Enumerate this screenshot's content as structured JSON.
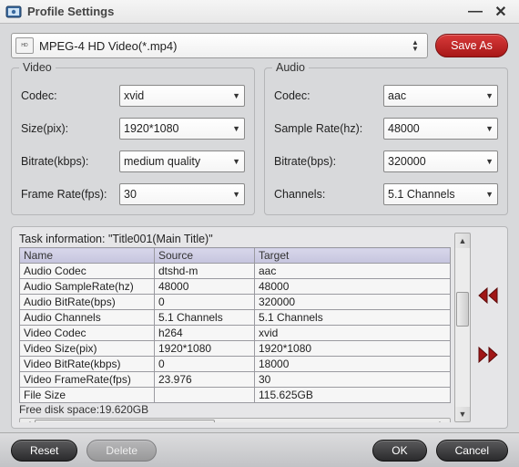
{
  "window": {
    "title": "Profile Settings"
  },
  "profile": {
    "selected": "MPEG-4 HD Video(*.mp4)",
    "save_as": "Save As"
  },
  "video": {
    "legend": "Video",
    "codec_label": "Codec:",
    "codec": "xvid",
    "size_label": "Size(pix):",
    "size": "1920*1080",
    "bitrate_label": "Bitrate(kbps):",
    "bitrate": "medium quality",
    "framerate_label": "Frame Rate(fps):",
    "framerate": "30"
  },
  "audio": {
    "legend": "Audio",
    "codec_label": "Codec:",
    "codec": "aac",
    "samplerate_label": "Sample Rate(hz):",
    "samplerate": "48000",
    "bitrate_label": "Bitrate(bps):",
    "bitrate": "320000",
    "channels_label": "Channels:",
    "channels": "5.1 Channels"
  },
  "task": {
    "caption": "Task information: \"Title001(Main Title)\"",
    "headers": {
      "name": "Name",
      "source": "Source",
      "target": "Target"
    },
    "rows": [
      {
        "name": "Audio Codec",
        "source": "dtshd-m",
        "target": "aac"
      },
      {
        "name": "Audio SampleRate(hz)",
        "source": "48000",
        "target": "48000"
      },
      {
        "name": "Audio BitRate(bps)",
        "source": "0",
        "target": "320000"
      },
      {
        "name": "Audio Channels",
        "source": "5.1 Channels",
        "target": "5.1 Channels"
      },
      {
        "name": "Video Codec",
        "source": "h264",
        "target": "xvid"
      },
      {
        "name": "Video Size(pix)",
        "source": "1920*1080",
        "target": "1920*1080"
      },
      {
        "name": "Video BitRate(kbps)",
        "source": "0",
        "target": "18000"
      },
      {
        "name": "Video FrameRate(fps)",
        "source": "23.976",
        "target": "30"
      },
      {
        "name": "File Size",
        "source": "",
        "target": "115.625GB"
      }
    ],
    "free_disk": "Free disk space:19.620GB"
  },
  "buttons": {
    "reset": "Reset",
    "delete": "Delete",
    "ok": "OK",
    "cancel": "Cancel"
  }
}
